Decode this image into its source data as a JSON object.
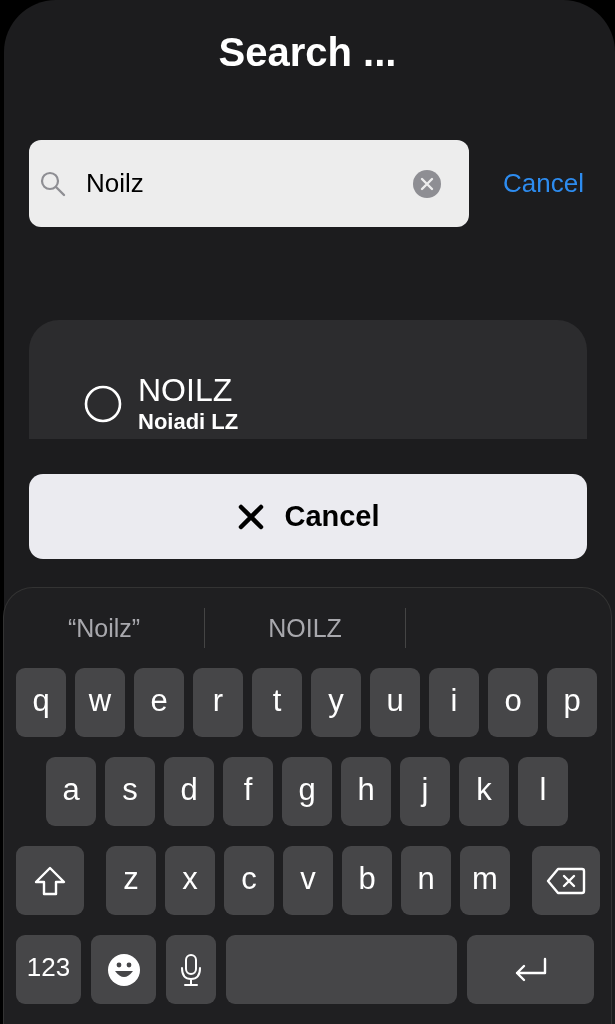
{
  "title": "Search ...",
  "search": {
    "value": "Noilz"
  },
  "cancel_link": "Cancel",
  "results": [
    {
      "title": "NOILZ",
      "subtitle": "Noiadi LZ",
      "selected": false
    }
  ],
  "cancel_button": {
    "label": "Cancel"
  },
  "keyboard": {
    "suggestions": [
      "“Noilz”",
      "NOILZ"
    ],
    "rows": [
      [
        {
          "kind": "letter",
          "label": "q"
        },
        {
          "kind": "letter",
          "label": "w"
        },
        {
          "kind": "letter",
          "label": "e"
        },
        {
          "kind": "letter",
          "label": "r"
        },
        {
          "kind": "letter",
          "label": "t"
        },
        {
          "kind": "letter",
          "label": "y"
        },
        {
          "kind": "letter",
          "label": "u"
        },
        {
          "kind": "letter",
          "label": "i"
        },
        {
          "kind": "letter",
          "label": "o"
        },
        {
          "kind": "letter",
          "label": "p"
        }
      ],
      [
        {
          "kind": "letter",
          "label": "a"
        },
        {
          "kind": "letter",
          "label": "s"
        },
        {
          "kind": "letter",
          "label": "d"
        },
        {
          "kind": "letter",
          "label": "f"
        },
        {
          "kind": "letter",
          "label": "g"
        },
        {
          "kind": "letter",
          "label": "h"
        },
        {
          "kind": "letter",
          "label": "j"
        },
        {
          "kind": "letter",
          "label": "k"
        },
        {
          "kind": "letter",
          "label": "l"
        }
      ],
      [
        {
          "kind": "shift"
        },
        {
          "kind": "letter",
          "label": "z"
        },
        {
          "kind": "letter",
          "label": "x"
        },
        {
          "kind": "letter",
          "label": "c"
        },
        {
          "kind": "letter",
          "label": "v"
        },
        {
          "kind": "letter",
          "label": "b"
        },
        {
          "kind": "letter",
          "label": "n"
        },
        {
          "kind": "letter",
          "label": "m"
        },
        {
          "kind": "delete"
        }
      ],
      [
        {
          "kind": "numbers",
          "label": "123"
        },
        {
          "kind": "emoji"
        },
        {
          "kind": "mic"
        },
        {
          "kind": "space"
        },
        {
          "kind": "return"
        }
      ]
    ]
  }
}
